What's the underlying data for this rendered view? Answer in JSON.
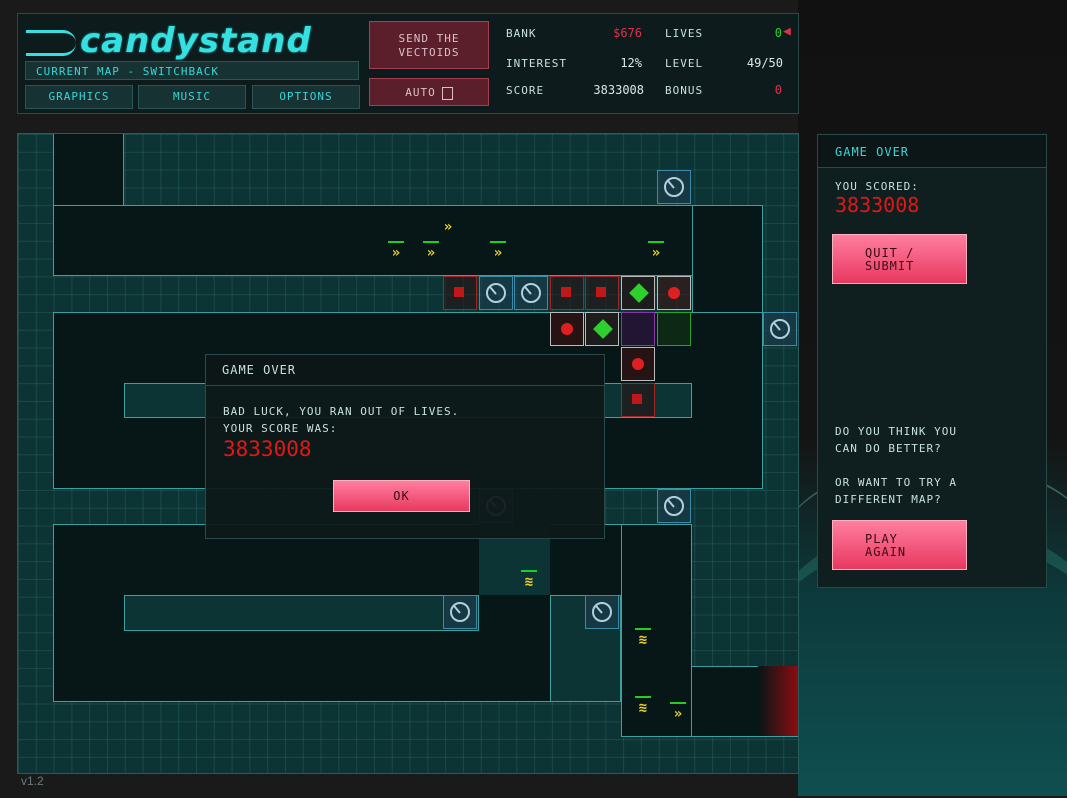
{
  "header": {
    "logo": "candystand",
    "current_map": "Current map - Switchback",
    "buttons": {
      "graphics": "Graphics",
      "music": "Music",
      "options": "Options"
    },
    "send_line1": "Send the",
    "send_line2": "Vectoids",
    "auto_label": "Auto"
  },
  "stats": {
    "bank_label": "Bank",
    "bank_value": "$676",
    "lives_label": "Lives",
    "lives_value": "0",
    "interest_label": "Interest",
    "interest_value": "12%",
    "level_label": "Level",
    "level_value": "49/50",
    "score_label": "Score",
    "score_value": "3833008",
    "bonus_label": "Bonus",
    "bonus_value": "0"
  },
  "colors": {
    "accent": "#38d6d6",
    "danger": "#e01818",
    "pink": "#e8385f",
    "green": "#2ed02e"
  },
  "modal": {
    "title": "Game Over",
    "line1": "Bad luck, you ran out of lives.",
    "line2": "Your score was:",
    "score": "3833008",
    "ok": "OK"
  },
  "side": {
    "title": "Game Over",
    "you_scored": "You scored:",
    "score": "3833008",
    "quit_line1": "Quit /",
    "quit_line2": "Submit",
    "q1_line1": "Do you think you",
    "q1_line2": "can do better?",
    "q2_line1": "Or want to try a",
    "q2_line2": "different map?",
    "play_line1": "Play",
    "play_line2": "Again"
  },
  "version": "v1.2"
}
